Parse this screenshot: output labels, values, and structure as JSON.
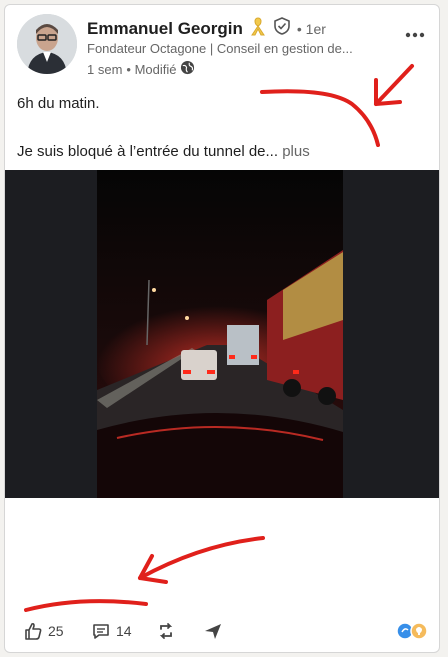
{
  "post": {
    "author_name": "Emmanuel Georgin",
    "degree": "• 1er",
    "headline": "Fondateur Octagone | Conseil en gestion de...",
    "time": "1 sem",
    "edited": "• Modifié",
    "text_line1": "6h du matin.",
    "text_line2": "Je suis bloqué à l’entrée du tunnel de...",
    "see_more": "plus"
  },
  "social": {
    "likes": "25",
    "comments": "14"
  },
  "icons": {
    "award": "yellow-ribbon-icon",
    "verified": "shield-check-icon",
    "visibility": "globe-icon",
    "more": "ellipsis-icon",
    "like": "thumbs-up-icon",
    "comment": "comment-icon",
    "repost": "repost-icon",
    "send": "send-icon",
    "reactions": "reaction-icons"
  },
  "colors": {
    "annotation": "#e0201b",
    "ribbon": "#f2c94c"
  }
}
